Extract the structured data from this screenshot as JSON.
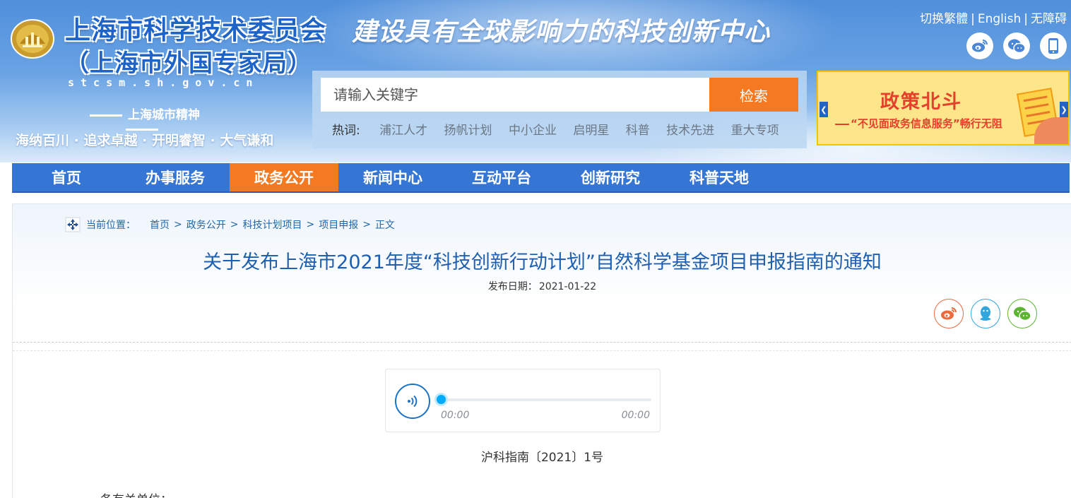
{
  "header": {
    "site_title": "上海市科学技术委员会",
    "site_subtitle": "（上海市外国专家局）",
    "domain": "stcsm.sh.gov.cn",
    "spirit_title": "上海城市精神",
    "spirit_motto": "海纳百川 · 追求卓越 · 开明睿智 · 大气谦和",
    "slogan": "建设具有全球影响力的科技创新中心",
    "top_links": [
      "切换繁體",
      "English",
      "无障碍"
    ],
    "social_icons": [
      "weibo-icon",
      "wechat-icon",
      "mobile-icon"
    ]
  },
  "search": {
    "placeholder": "请输入关键字",
    "button": "检索",
    "hot_label": "热词:",
    "hot_words": [
      "浦江人才",
      "扬帆计划",
      "中小企业",
      "启明星",
      "科普",
      "技术先进",
      "重大专项"
    ]
  },
  "banner": {
    "title": "政策北斗",
    "subtitle": "“不见面政务信息服务”畅行无阻"
  },
  "nav": {
    "items": [
      "首页",
      "办事服务",
      "政务公开",
      "新闻中心",
      "互动平台",
      "创新研究",
      "科普天地"
    ],
    "active_index": 2
  },
  "breadcrumb": {
    "label": "当前位置：",
    "items": [
      "首页",
      "政务公开",
      "科技计划项目",
      "项目申报",
      "正文"
    ]
  },
  "article": {
    "title": "关于发布上海市2021年度“科技创新行动计划”自然科学基金项目申报指南的通知",
    "date_label": "发布日期：",
    "date": "2021-01-22",
    "doc_number": "沪科指南〔2021〕1号",
    "salutation": "各有关单位："
  },
  "share": [
    "weibo-icon",
    "qq-icon",
    "wechat-icon"
  ],
  "player": {
    "current_time": "00:00",
    "duration": "00:00",
    "progress": 0
  },
  "colors": {
    "nav_bg": "#3575d3",
    "accent": "#f47920",
    "title": "#1f5fb0",
    "link": "#2266a8"
  }
}
